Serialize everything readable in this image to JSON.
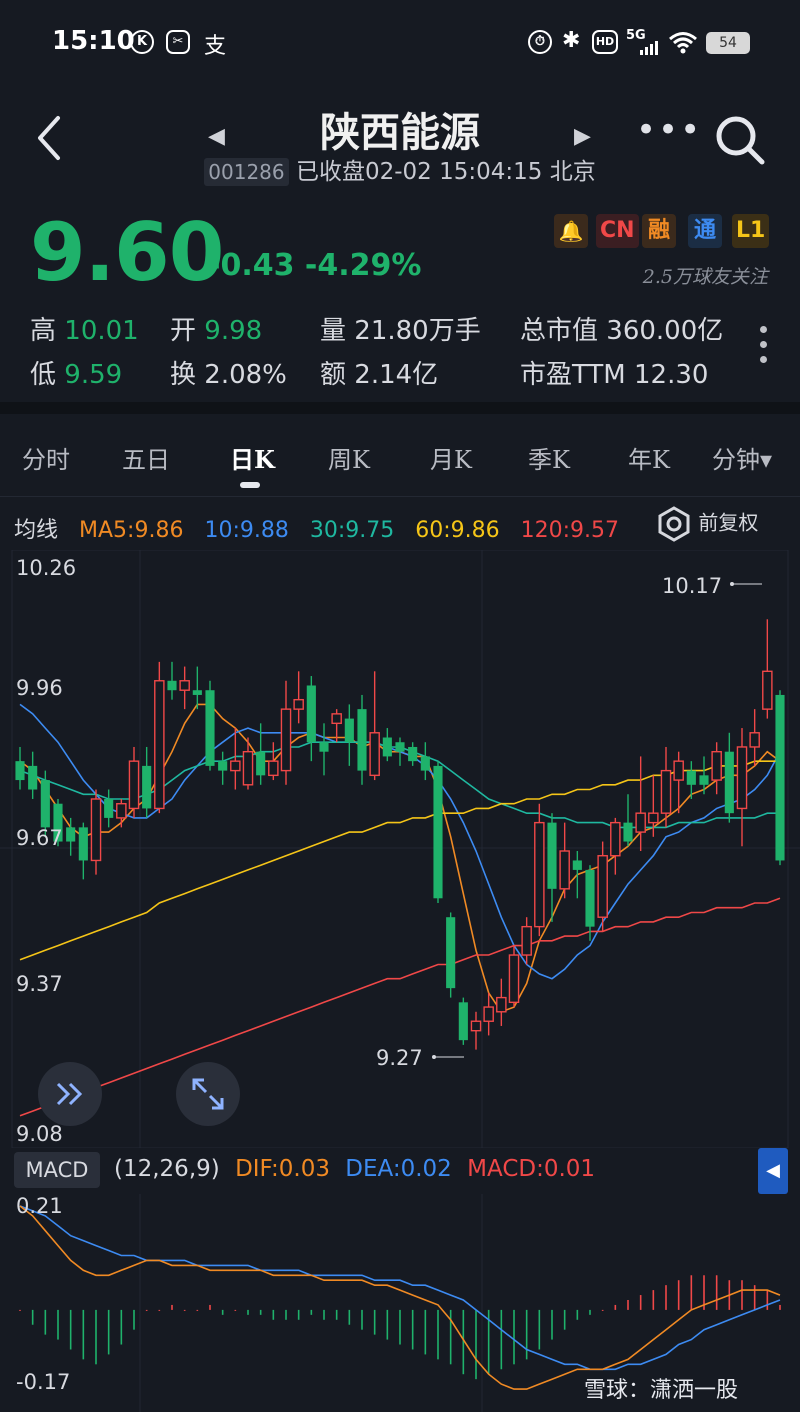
{
  "status_bar": {
    "time": "15:10",
    "battery": "54",
    "network": "5G"
  },
  "header": {
    "title": "陕西能源",
    "code": "001286",
    "status_text": "已收盘02-02 15:04:15 北京"
  },
  "quote": {
    "price": "9.60",
    "change": "-0.43 -4.29%",
    "tags": [
      "CN",
      "融",
      "通",
      "L1"
    ],
    "followers": "2.5万球友关注",
    "stats": [
      {
        "label": "高",
        "value": "10.01"
      },
      {
        "label": "开",
        "value": "9.98"
      },
      {
        "label": "量",
        "value": "21.80万手"
      },
      {
        "label": "总市值",
        "value": "360.00亿"
      },
      {
        "label": "低",
        "value": "9.59"
      },
      {
        "label": "换",
        "value": "2.08%"
      },
      {
        "label": "额",
        "value": "2.14亿"
      },
      {
        "label": "市盈TTM",
        "value": "12.30"
      }
    ]
  },
  "tabs": [
    "分时",
    "五日",
    "日K",
    "周K",
    "月K",
    "季K",
    "年K",
    "分钟"
  ],
  "active_tab": "日K",
  "ma_legend": {
    "label": "均线",
    "items": [
      {
        "text": "MA5:9.86",
        "color": "#f08a24"
      },
      {
        "text": "10:9.88",
        "color": "#3d8bf2"
      },
      {
        "text": "30:9.75",
        "color": "#1fb8a0"
      },
      {
        "text": "60:9.86",
        "color": "#f5c518"
      },
      {
        "text": "120:9.57",
        "color": "#f04848"
      }
    ],
    "adjust_label": "前复权"
  },
  "price_axis": [
    "10.26",
    "9.96",
    "9.67",
    "9.37",
    "9.08"
  ],
  "annotations": {
    "high": "10.17",
    "low": "9.27"
  },
  "macd": {
    "chip": "MACD",
    "params": "(12,26,9)",
    "dif": "DIF:0.03",
    "dea": "DEA:0.02",
    "macd": "MACD:0.01",
    "axis_top": "0.21",
    "axis_bottom": "-0.17"
  },
  "watermark": "雪球：潇洒一股",
  "colors": {
    "up": "#f04848",
    "down": "#1fb26b",
    "background": "#161a22"
  },
  "chart_data": {
    "type": "candlestick",
    "ylim": [
      9.08,
      10.26
    ],
    "candles": [
      {
        "o": 9.86,
        "c": 9.82,
        "h": 9.89,
        "l": 9.8
      },
      {
        "o": 9.85,
        "c": 9.8,
        "h": 9.88,
        "l": 9.78
      },
      {
        "o": 9.82,
        "c": 9.72,
        "h": 9.84,
        "l": 9.7
      },
      {
        "o": 9.77,
        "c": 9.69,
        "h": 9.78,
        "l": 9.68
      },
      {
        "o": 9.72,
        "c": 9.69,
        "h": 9.74,
        "l": 9.66
      },
      {
        "o": 9.72,
        "c": 9.65,
        "h": 9.73,
        "l": 9.61
      },
      {
        "o": 9.65,
        "c": 9.78,
        "h": 9.8,
        "l": 9.62
      },
      {
        "o": 9.78,
        "c": 9.74,
        "h": 9.8,
        "l": 9.72
      },
      {
        "o": 9.74,
        "c": 9.77,
        "h": 9.78,
        "l": 9.72
      },
      {
        "o": 9.76,
        "c": 9.86,
        "h": 9.89,
        "l": 9.74
      },
      {
        "o": 9.85,
        "c": 9.76,
        "h": 9.89,
        "l": 9.74
      },
      {
        "o": 9.76,
        "c": 10.03,
        "h": 10.07,
        "l": 9.75
      },
      {
        "o": 10.03,
        "c": 10.01,
        "h": 10.07,
        "l": 9.99
      },
      {
        "o": 10.01,
        "c": 10.03,
        "h": 10.06,
        "l": 9.97
      },
      {
        "o": 10.01,
        "c": 10.0,
        "h": 10.06,
        "l": 9.97
      },
      {
        "o": 10.01,
        "c": 9.85,
        "h": 10.03,
        "l": 9.84
      },
      {
        "o": 9.86,
        "c": 9.84,
        "h": 9.88,
        "l": 9.81
      },
      {
        "o": 9.84,
        "c": 9.86,
        "h": 9.93,
        "l": 9.8
      },
      {
        "o": 9.81,
        "c": 9.88,
        "h": 9.91,
        "l": 9.8
      },
      {
        "o": 9.88,
        "c": 9.83,
        "h": 9.94,
        "l": 9.81
      },
      {
        "o": 9.83,
        "c": 9.86,
        "h": 9.9,
        "l": 9.82
      },
      {
        "o": 9.84,
        "c": 9.97,
        "h": 10.03,
        "l": 9.81
      },
      {
        "o": 9.97,
        "c": 9.99,
        "h": 10.05,
        "l": 9.94
      },
      {
        "o": 10.02,
        "c": 9.9,
        "h": 10.04,
        "l": 9.86
      },
      {
        "o": 9.9,
        "c": 9.88,
        "h": 9.94,
        "l": 9.83
      },
      {
        "o": 9.94,
        "c": 9.96,
        "h": 9.97,
        "l": 9.9
      },
      {
        "o": 9.95,
        "c": 9.9,
        "h": 9.98,
        "l": 9.85
      },
      {
        "o": 9.97,
        "c": 9.84,
        "h": 10.0,
        "l": 9.81
      },
      {
        "o": 9.83,
        "c": 9.92,
        "h": 10.05,
        "l": 9.82
      },
      {
        "o": 9.91,
        "c": 9.87,
        "h": 9.93,
        "l": 9.86
      },
      {
        "o": 9.9,
        "c": 9.88,
        "h": 9.91,
        "l": 9.85
      },
      {
        "o": 9.89,
        "c": 9.86,
        "h": 9.9,
        "l": 9.85
      },
      {
        "o": 9.87,
        "c": 9.84,
        "h": 9.9,
        "l": 9.82
      },
      {
        "o": 9.85,
        "c": 9.57,
        "h": 9.86,
        "l": 9.56
      },
      {
        "o": 9.53,
        "c": 9.38,
        "h": 9.54,
        "l": 9.36
      },
      {
        "o": 9.35,
        "c": 9.27,
        "h": 9.36,
        "l": 9.26
      },
      {
        "o": 9.29,
        "c": 9.31,
        "h": 9.33,
        "l": 9.25
      },
      {
        "o": 9.31,
        "c": 9.34,
        "h": 9.37,
        "l": 9.28
      },
      {
        "o": 9.33,
        "c": 9.36,
        "h": 9.4,
        "l": 9.3
      },
      {
        "o": 9.35,
        "c": 9.45,
        "h": 9.47,
        "l": 9.34
      },
      {
        "o": 9.45,
        "c": 9.51,
        "h": 9.53,
        "l": 9.43
      },
      {
        "o": 9.51,
        "c": 9.73,
        "h": 9.77,
        "l": 9.49
      },
      {
        "o": 9.73,
        "c": 9.59,
        "h": 9.75,
        "l": 9.52
      },
      {
        "o": 9.59,
        "c": 9.67,
        "h": 9.73,
        "l": 9.57
      },
      {
        "o": 9.65,
        "c": 9.63,
        "h": 9.67,
        "l": 9.57
      },
      {
        "o": 9.63,
        "c": 9.51,
        "h": 9.64,
        "l": 9.48
      },
      {
        "o": 9.53,
        "c": 9.66,
        "h": 9.69,
        "l": 9.5
      },
      {
        "o": 9.66,
        "c": 9.73,
        "h": 9.74,
        "l": 9.62
      },
      {
        "o": 9.73,
        "c": 9.69,
        "h": 9.79,
        "l": 9.68
      },
      {
        "o": 9.71,
        "c": 9.75,
        "h": 9.87,
        "l": 9.67
      },
      {
        "o": 9.73,
        "c": 9.75,
        "h": 9.83,
        "l": 9.7
      },
      {
        "o": 9.75,
        "c": 9.84,
        "h": 9.89,
        "l": 9.72
      },
      {
        "o": 9.82,
        "c": 9.86,
        "h": 9.88,
        "l": 9.75
      },
      {
        "o": 9.84,
        "c": 9.81,
        "h": 9.86,
        "l": 9.78
      },
      {
        "o": 9.83,
        "c": 9.81,
        "h": 9.87,
        "l": 9.79
      },
      {
        "o": 9.82,
        "c": 9.88,
        "h": 9.9,
        "l": 9.79
      },
      {
        "o": 9.88,
        "c": 9.75,
        "h": 9.92,
        "l": 9.73
      },
      {
        "o": 9.76,
        "c": 9.89,
        "h": 9.93,
        "l": 9.68
      },
      {
        "o": 9.89,
        "c": 9.92,
        "h": 9.97,
        "l": 9.85
      },
      {
        "o": 9.97,
        "c": 10.05,
        "h": 10.16,
        "l": 9.95
      },
      {
        "o": 10.0,
        "c": 9.65,
        "h": 10.01,
        "l": 9.64
      }
    ],
    "ma_series": [
      {
        "name": "MA5",
        "color": "#f08a24",
        "values": [
          9.86,
          9.84,
          9.8,
          9.76,
          9.72,
          9.7,
          9.71,
          9.71,
          9.73,
          9.76,
          9.78,
          9.83,
          9.88,
          9.94,
          9.98,
          9.98,
          9.95,
          9.93,
          9.9,
          9.86,
          9.86,
          9.89,
          9.91,
          9.92,
          9.91,
          9.91,
          9.91,
          9.89,
          9.9,
          9.88,
          9.88,
          9.87,
          9.87,
          9.8,
          9.7,
          9.58,
          9.46,
          9.37,
          9.33,
          9.34,
          9.39,
          9.48,
          9.53,
          9.59,
          9.62,
          9.63,
          9.64,
          9.66,
          9.68,
          9.71,
          9.72,
          9.74,
          9.76,
          9.79,
          9.8,
          9.82,
          9.83,
          9.83,
          9.85,
          9.88,
          9.86
        ]
      },
      {
        "name": "10",
        "color": "#3d8bf2",
        "values": [
          9.98,
          9.96,
          9.93,
          9.9,
          9.86,
          9.82,
          9.79,
          9.76,
          9.75,
          9.74,
          9.74,
          9.76,
          9.78,
          9.82,
          9.85,
          9.88,
          9.9,
          9.92,
          9.93,
          9.92,
          9.92,
          9.92,
          9.92,
          9.92,
          9.91,
          9.9,
          9.9,
          9.9,
          9.9,
          9.89,
          9.88,
          9.87,
          9.85,
          9.82,
          9.78,
          9.73,
          9.67,
          9.6,
          9.53,
          9.47,
          9.43,
          9.41,
          9.4,
          9.42,
          9.45,
          9.47,
          9.52,
          9.56,
          9.6,
          9.63,
          9.66,
          9.7,
          9.71,
          9.73,
          9.74,
          9.76,
          9.77,
          9.78,
          9.8,
          9.83,
          9.88
        ]
      },
      {
        "name": "30",
        "color": "#1fb8a0",
        "values": [
          9.84,
          9.83,
          9.82,
          9.81,
          9.8,
          9.79,
          9.79,
          9.78,
          9.78,
          9.78,
          9.79,
          9.8,
          9.82,
          9.84,
          9.85,
          9.86,
          9.86,
          9.87,
          9.87,
          9.88,
          9.88,
          9.89,
          9.89,
          9.9,
          9.9,
          9.9,
          9.9,
          9.9,
          9.9,
          9.89,
          9.89,
          9.88,
          9.87,
          9.86,
          9.84,
          9.82,
          9.8,
          9.78,
          9.77,
          9.76,
          9.75,
          9.75,
          9.74,
          9.74,
          9.73,
          9.73,
          9.73,
          9.72,
          9.72,
          9.72,
          9.72,
          9.72,
          9.73,
          9.73,
          9.73,
          9.74,
          9.74,
          9.74,
          9.74,
          9.75,
          9.75
        ]
      },
      {
        "name": "60",
        "color": "#f5c518",
        "values": [
          9.44,
          9.45,
          9.46,
          9.47,
          9.48,
          9.49,
          9.5,
          9.51,
          9.52,
          9.53,
          9.54,
          9.56,
          9.57,
          9.58,
          9.59,
          9.6,
          9.61,
          9.62,
          9.63,
          9.64,
          9.65,
          9.66,
          9.67,
          9.68,
          9.69,
          9.7,
          9.71,
          9.71,
          9.72,
          9.73,
          9.73,
          9.74,
          9.74,
          9.75,
          9.75,
          9.75,
          9.76,
          9.76,
          9.77,
          9.77,
          9.78,
          9.78,
          9.79,
          9.79,
          9.8,
          9.8,
          9.81,
          9.81,
          9.82,
          9.82,
          9.83,
          9.83,
          9.84,
          9.84,
          9.84,
          9.85,
          9.85,
          9.85,
          9.86,
          9.86,
          9.86
        ]
      },
      {
        "name": "120",
        "color": "#f04848",
        "values": [
          9.11,
          9.12,
          9.13,
          9.14,
          9.15,
          9.16,
          9.17,
          9.18,
          9.19,
          9.2,
          9.21,
          9.22,
          9.23,
          9.24,
          9.25,
          9.26,
          9.27,
          9.28,
          9.29,
          9.3,
          9.31,
          9.32,
          9.33,
          9.34,
          9.35,
          9.36,
          9.37,
          9.38,
          9.39,
          9.4,
          9.4,
          9.41,
          9.42,
          9.43,
          9.43,
          9.44,
          9.45,
          9.45,
          9.46,
          9.47,
          9.47,
          9.48,
          9.48,
          9.49,
          9.49,
          9.5,
          9.5,
          9.51,
          9.51,
          9.52,
          9.52,
          9.53,
          9.53,
          9.54,
          9.54,
          9.55,
          9.55,
          9.55,
          9.56,
          9.56,
          9.57
        ]
      }
    ],
    "macd_chart": {
      "ylim": [
        -0.17,
        0.21
      ],
      "dif": [
        0.21,
        0.19,
        0.16,
        0.13,
        0.1,
        0.08,
        0.07,
        0.07,
        0.08,
        0.09,
        0.1,
        0.1,
        0.09,
        0.09,
        0.09,
        0.08,
        0.08,
        0.08,
        0.08,
        0.08,
        0.07,
        0.07,
        0.07,
        0.07,
        0.06,
        0.06,
        0.06,
        0.06,
        0.05,
        0.05,
        0.04,
        0.03,
        0.02,
        0.01,
        -0.02,
        -0.06,
        -0.1,
        -0.13,
        -0.15,
        -0.16,
        -0.16,
        -0.15,
        -0.14,
        -0.13,
        -0.12,
        -0.12,
        -0.12,
        -0.11,
        -0.1,
        -0.08,
        -0.06,
        -0.04,
        -0.02,
        0.0,
        0.01,
        0.02,
        0.03,
        0.04,
        0.04,
        0.04,
        0.03
      ],
      "dea": [
        0.21,
        0.2,
        0.19,
        0.17,
        0.15,
        0.14,
        0.13,
        0.12,
        0.11,
        0.11,
        0.1,
        0.1,
        0.1,
        0.1,
        0.09,
        0.09,
        0.09,
        0.09,
        0.09,
        0.08,
        0.08,
        0.08,
        0.08,
        0.07,
        0.07,
        0.07,
        0.07,
        0.07,
        0.06,
        0.06,
        0.06,
        0.05,
        0.05,
        0.04,
        0.03,
        0.02,
        0.0,
        -0.02,
        -0.04,
        -0.06,
        -0.08,
        -0.09,
        -0.1,
        -0.11,
        -0.11,
        -0.12,
        -0.12,
        -0.12,
        -0.11,
        -0.11,
        -0.1,
        -0.09,
        -0.07,
        -0.06,
        -0.04,
        -0.03,
        -0.02,
        -0.01,
        0.0,
        0.01,
        0.02
      ],
      "macd": [
        0.0,
        -0.03,
        -0.05,
        -0.06,
        -0.08,
        -0.1,
        -0.11,
        -0.09,
        -0.07,
        -0.04,
        0.0,
        0.0,
        0.01,
        0.0,
        0.0,
        0.01,
        -0.01,
        0.0,
        -0.01,
        -0.01,
        -0.02,
        -0.02,
        -0.02,
        -0.01,
        -0.02,
        -0.02,
        -0.03,
        -0.04,
        -0.05,
        -0.06,
        -0.07,
        -0.08,
        -0.09,
        -0.1,
        -0.11,
        -0.13,
        -0.14,
        -0.13,
        -0.12,
        -0.11,
        -0.1,
        -0.08,
        -0.06,
        -0.04,
        -0.02,
        -0.01,
        0.0,
        0.01,
        0.02,
        0.03,
        0.04,
        0.05,
        0.06,
        0.07,
        0.07,
        0.07,
        0.06,
        0.06,
        0.05,
        0.04,
        0.01
      ]
    }
  }
}
